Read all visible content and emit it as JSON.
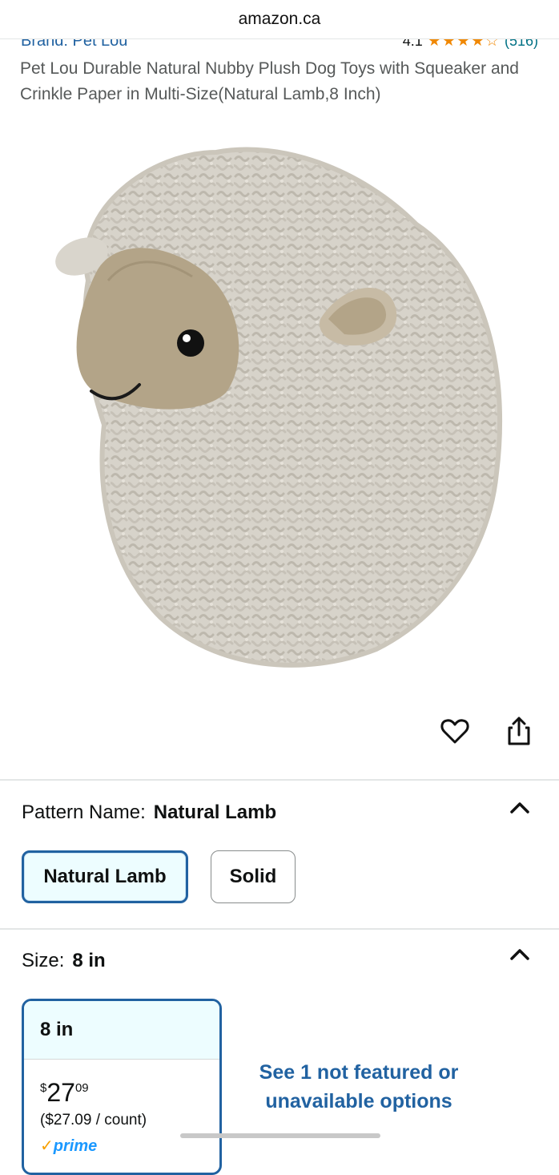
{
  "browser": {
    "url": "amazon.ca"
  },
  "product": {
    "brand": "Brand: Pet Lou",
    "rating_score": "4.1",
    "rating_stars": "★★★★☆",
    "rating_count": "(516)",
    "title": "Pet Lou Durable Natural Nubby Plush Dog Toys with Squeaker and Crinkle Paper in Multi-Size(Natural Lamb,8 Inch)",
    "image_icon": "plush-lamb-toy"
  },
  "actions": {
    "wishlist_icon": "heart-icon",
    "share_icon": "share-icon"
  },
  "pattern": {
    "label": "Pattern Name:",
    "selected": "Natural Lamb",
    "options": [
      "Natural Lamb",
      "Solid"
    ]
  },
  "size": {
    "label": "Size:",
    "selected": "8 in",
    "card": {
      "name": "8 in",
      "price_symbol": "$",
      "price_whole": "27",
      "price_fraction": "09",
      "unit_price": "($27.09 / count)",
      "prime_label": "prime"
    },
    "not_featured": "See 1 not featured or unavailable options"
  },
  "colors": {
    "link": "#2162a1",
    "star": "#f08804",
    "selected_border": "#2162a1"
  }
}
